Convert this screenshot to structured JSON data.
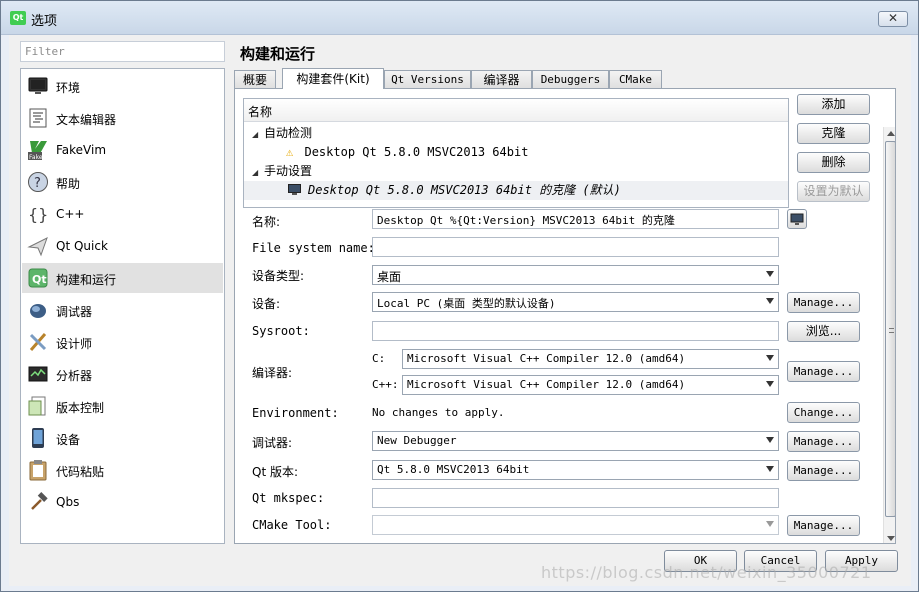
{
  "window": {
    "title": "选项",
    "app_icon": "Qt",
    "close_label": "✕"
  },
  "sidebar": {
    "filter_placeholder": "Filter",
    "items": [
      {
        "label": "环境",
        "icon": "monitor-icon"
      },
      {
        "label": "文本编辑器",
        "icon": "text-editor-icon"
      },
      {
        "label": "FakeVim",
        "icon": "fakevim-icon"
      },
      {
        "label": "帮助",
        "icon": "help-icon"
      },
      {
        "label": "C++",
        "icon": "cpp-braces-icon"
      },
      {
        "label": "Qt Quick",
        "icon": "qt-quick-icon"
      },
      {
        "label": "构建和运行",
        "icon": "qt-build-run-icon",
        "selected": true
      },
      {
        "label": "调试器",
        "icon": "debugger-icon"
      },
      {
        "label": "设计师",
        "icon": "designer-icon"
      },
      {
        "label": "分析器",
        "icon": "analyzer-icon"
      },
      {
        "label": "版本控制",
        "icon": "version-control-icon"
      },
      {
        "label": "设备",
        "icon": "device-icon"
      },
      {
        "label": "代码粘贴",
        "icon": "code-paste-icon"
      },
      {
        "label": "Qbs",
        "icon": "qbs-hammer-icon"
      }
    ]
  },
  "panel": {
    "title": "构建和运行",
    "tabs": [
      "概要",
      "构建套件(Kit)",
      "Qt Versions",
      "编译器",
      "Debuggers",
      "CMake"
    ],
    "active_tab": "构建套件(Kit)",
    "kits_tree": {
      "header": "名称",
      "auto_group": "自动检测",
      "auto_kit": "Desktop Qt 5.8.0 MSVC2013 64bit",
      "manual_group": "手动设置",
      "manual_kit": "Desktop Qt 5.8.0 MSVC2013 64bit 的克隆 (默认)"
    },
    "kit_buttons": {
      "add": "添加",
      "clone": "克隆",
      "remove": "删除",
      "make_default": "设置为默认"
    },
    "form": {
      "name_label": "名称:",
      "name_value": "Desktop Qt %{Qt:Version} MSVC2013 64bit 的克隆",
      "fs_name_label": "File system name:",
      "fs_name_value": "",
      "device_type_label": "设备类型:",
      "device_type_value": "桌面",
      "device_label": "设备:",
      "device_value": "Local PC (桌面 类型的默认设备)",
      "sysroot_label": "Sysroot:",
      "sysroot_value": "",
      "browse_label": "浏览...",
      "compiler_label": "编译器:",
      "compiler_c_label": "C:",
      "compiler_c_value": "Microsoft Visual C++ Compiler 12.0 (amd64)",
      "compiler_cpp_label": "C++:",
      "compiler_cpp_value": "Microsoft Visual C++ Compiler 12.0 (amd64)",
      "environment_label": "Environment:",
      "environment_value": "No changes to apply.",
      "change_label": "Change...",
      "debugger_label": "调试器:",
      "debugger_value": "New Debugger",
      "qt_version_label": "Qt 版本:",
      "qt_version_value": "Qt 5.8.0 MSVC2013 64bit",
      "mkspec_label": "Qt mkspec:",
      "mkspec_value": "",
      "cmake_tool_label": "CMake Tool:",
      "manage_label": "Manage..."
    }
  },
  "dialog_buttons": {
    "ok": "OK",
    "cancel": "Cancel",
    "apply": "Apply"
  },
  "watermark": "https://blog.csdn.net/weixin_35000721"
}
